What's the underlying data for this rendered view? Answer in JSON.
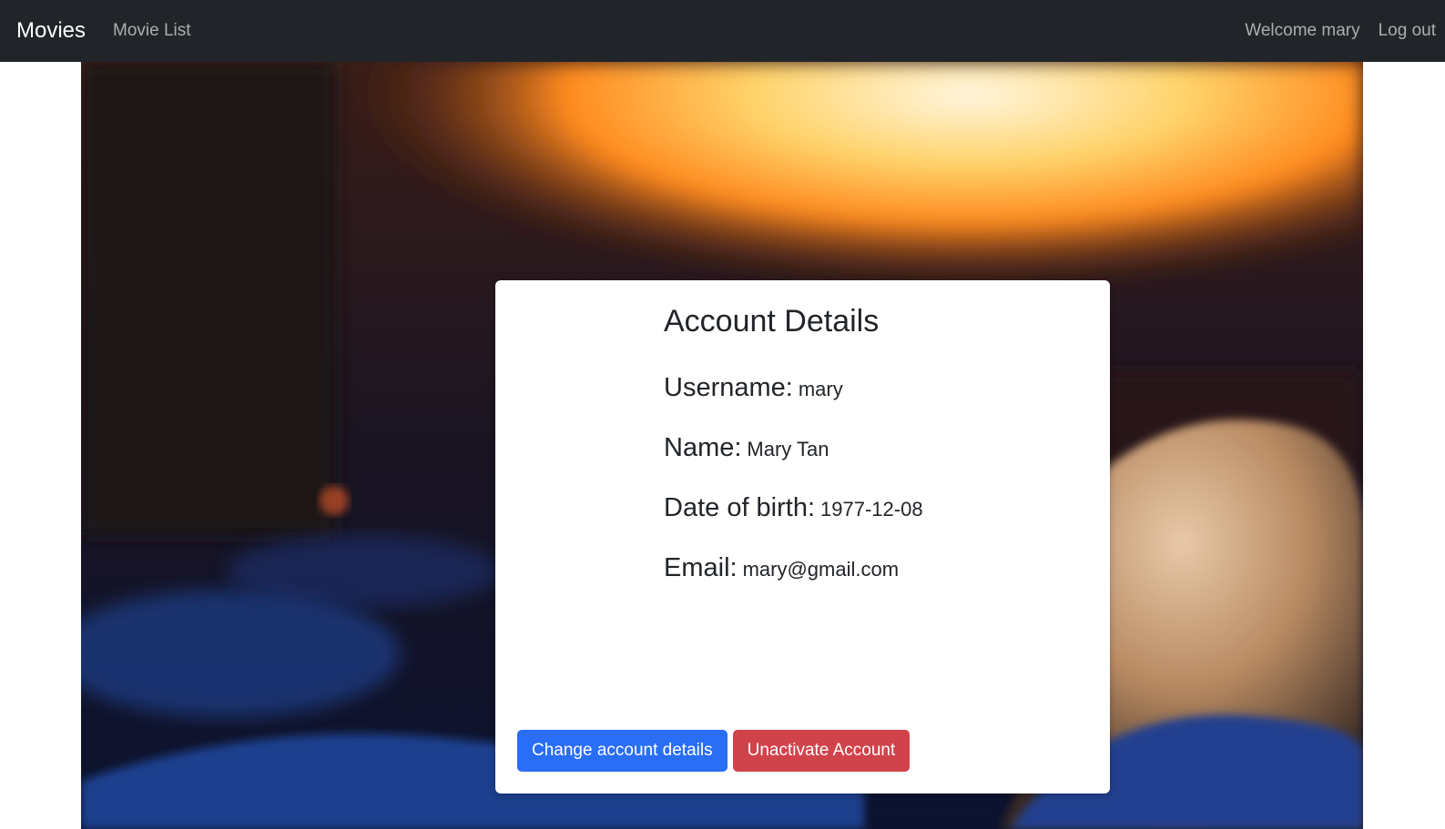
{
  "navbar": {
    "brand": "Movies",
    "links": [
      "Movie List"
    ],
    "welcome": "Welcome mary",
    "logout": "Log out"
  },
  "card": {
    "title": "Account Details",
    "fields": [
      {
        "label": "Username:",
        "value": "mary"
      },
      {
        "label": "Name:",
        "value": "Mary Tan"
      },
      {
        "label": "Date of birth:",
        "value": "1977-12-08"
      },
      {
        "label": "Email:",
        "value": "mary@gmail.com"
      }
    ],
    "buttons": {
      "change": "Change account details",
      "unactivate": "Unactivate Account"
    }
  },
  "colors": {
    "navbar_bg": "#212529",
    "primary": "#2a6ef5",
    "danger": "#d1434b"
  }
}
